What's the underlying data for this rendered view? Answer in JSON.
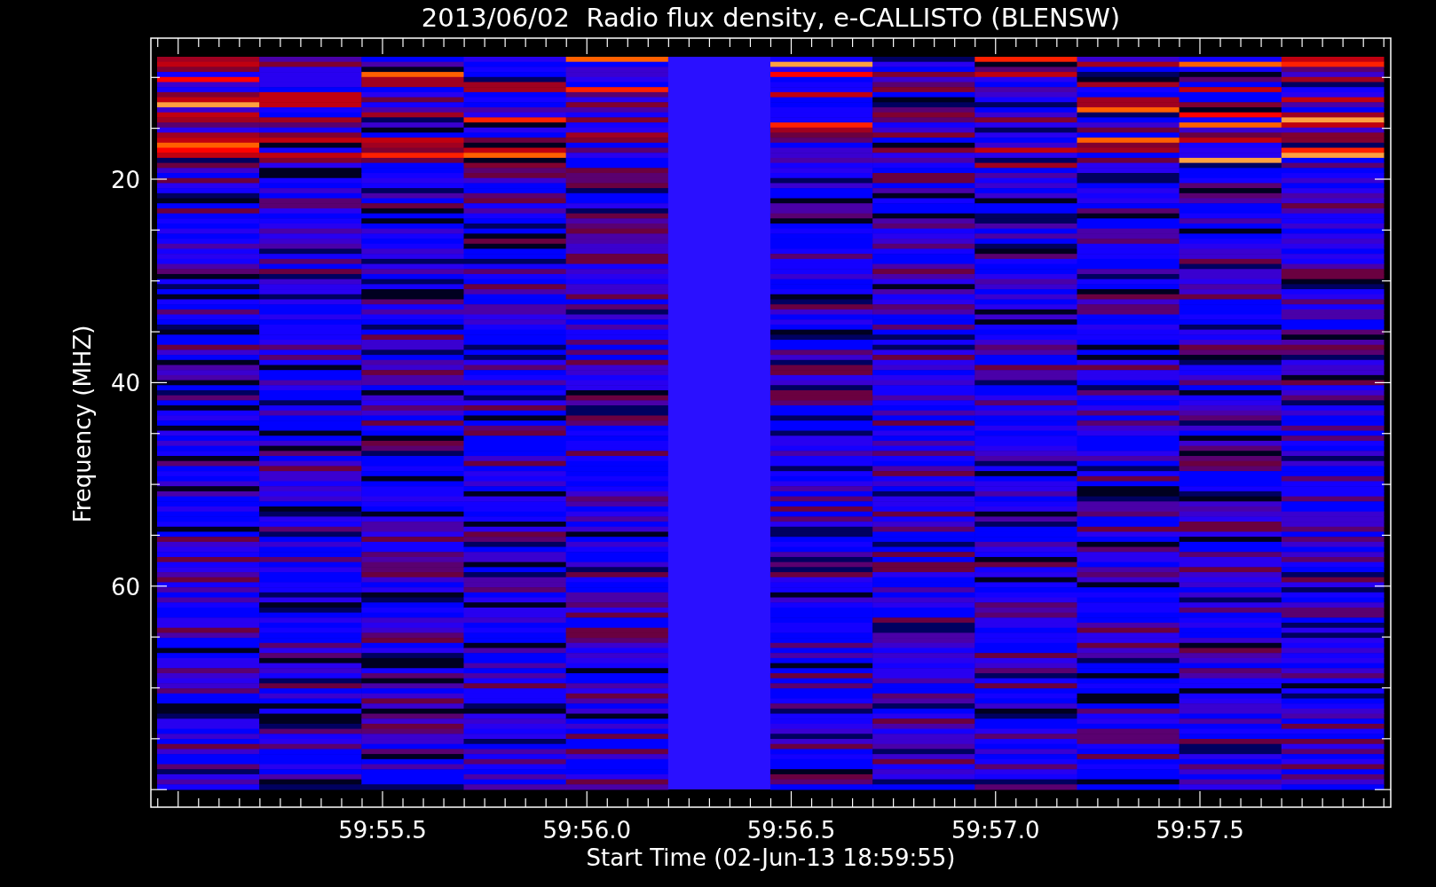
{
  "title": "2013/06/02  Radio flux density, e-CALLISTO (BLENSW)",
  "y_axis": {
    "label": "Frequency (MHZ)",
    "tick_labels": [
      "20",
      "40",
      "60"
    ]
  },
  "x_axis": {
    "label": "Start Time (02-Jun-13 18:59:55)",
    "tick_labels": [
      "59:55.5",
      "59:56.0",
      "59:56.5",
      "59:57.0",
      "59:57.5"
    ]
  }
}
